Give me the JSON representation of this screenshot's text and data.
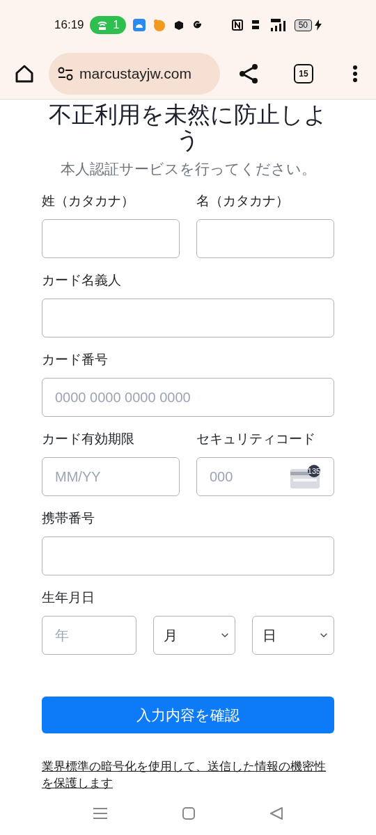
{
  "status_bar": {
    "time": "16:19",
    "hotspot_count": "1",
    "battery": "50"
  },
  "browser": {
    "url": "marcustayjw.com",
    "tab_count": "15"
  },
  "heading": "不正利用を未然に防止しよう",
  "subtitle": "本人認証サービスを行ってください。",
  "rows": [
    {
      "fields": [
        {
          "label": "姓（カタカナ）",
          "kind": "text"
        },
        {
          "label": "名（カタカナ）",
          "kind": "text"
        }
      ]
    },
    {
      "fields": [
        {
          "label": "カード名義人",
          "kind": "text"
        }
      ]
    },
    {
      "fields": [
        {
          "label": "カード番号",
          "kind": "text",
          "placeholder": "0000 0000 0000 0000"
        }
      ]
    },
    {
      "fields": [
        {
          "label": "カード有効期限",
          "kind": "text",
          "placeholder": "MM/YY"
        },
        {
          "label": "セキュリティコード",
          "kind": "cvc",
          "placeholder": "000",
          "badge": "135"
        }
      ]
    },
    {
      "fields": [
        {
          "label": "携帯番号",
          "kind": "text"
        }
      ]
    }
  ],
  "birthdate": {
    "label": "生年月日",
    "parts": [
      {
        "kind": "text",
        "placeholder": "年"
      },
      {
        "kind": "select",
        "value": "月"
      },
      {
        "kind": "select",
        "value": "日"
      }
    ]
  },
  "submit": "入力内容を確認",
  "footer_note": "業界標準の暗号化を使用して、送信した情報の機密性を保護します"
}
